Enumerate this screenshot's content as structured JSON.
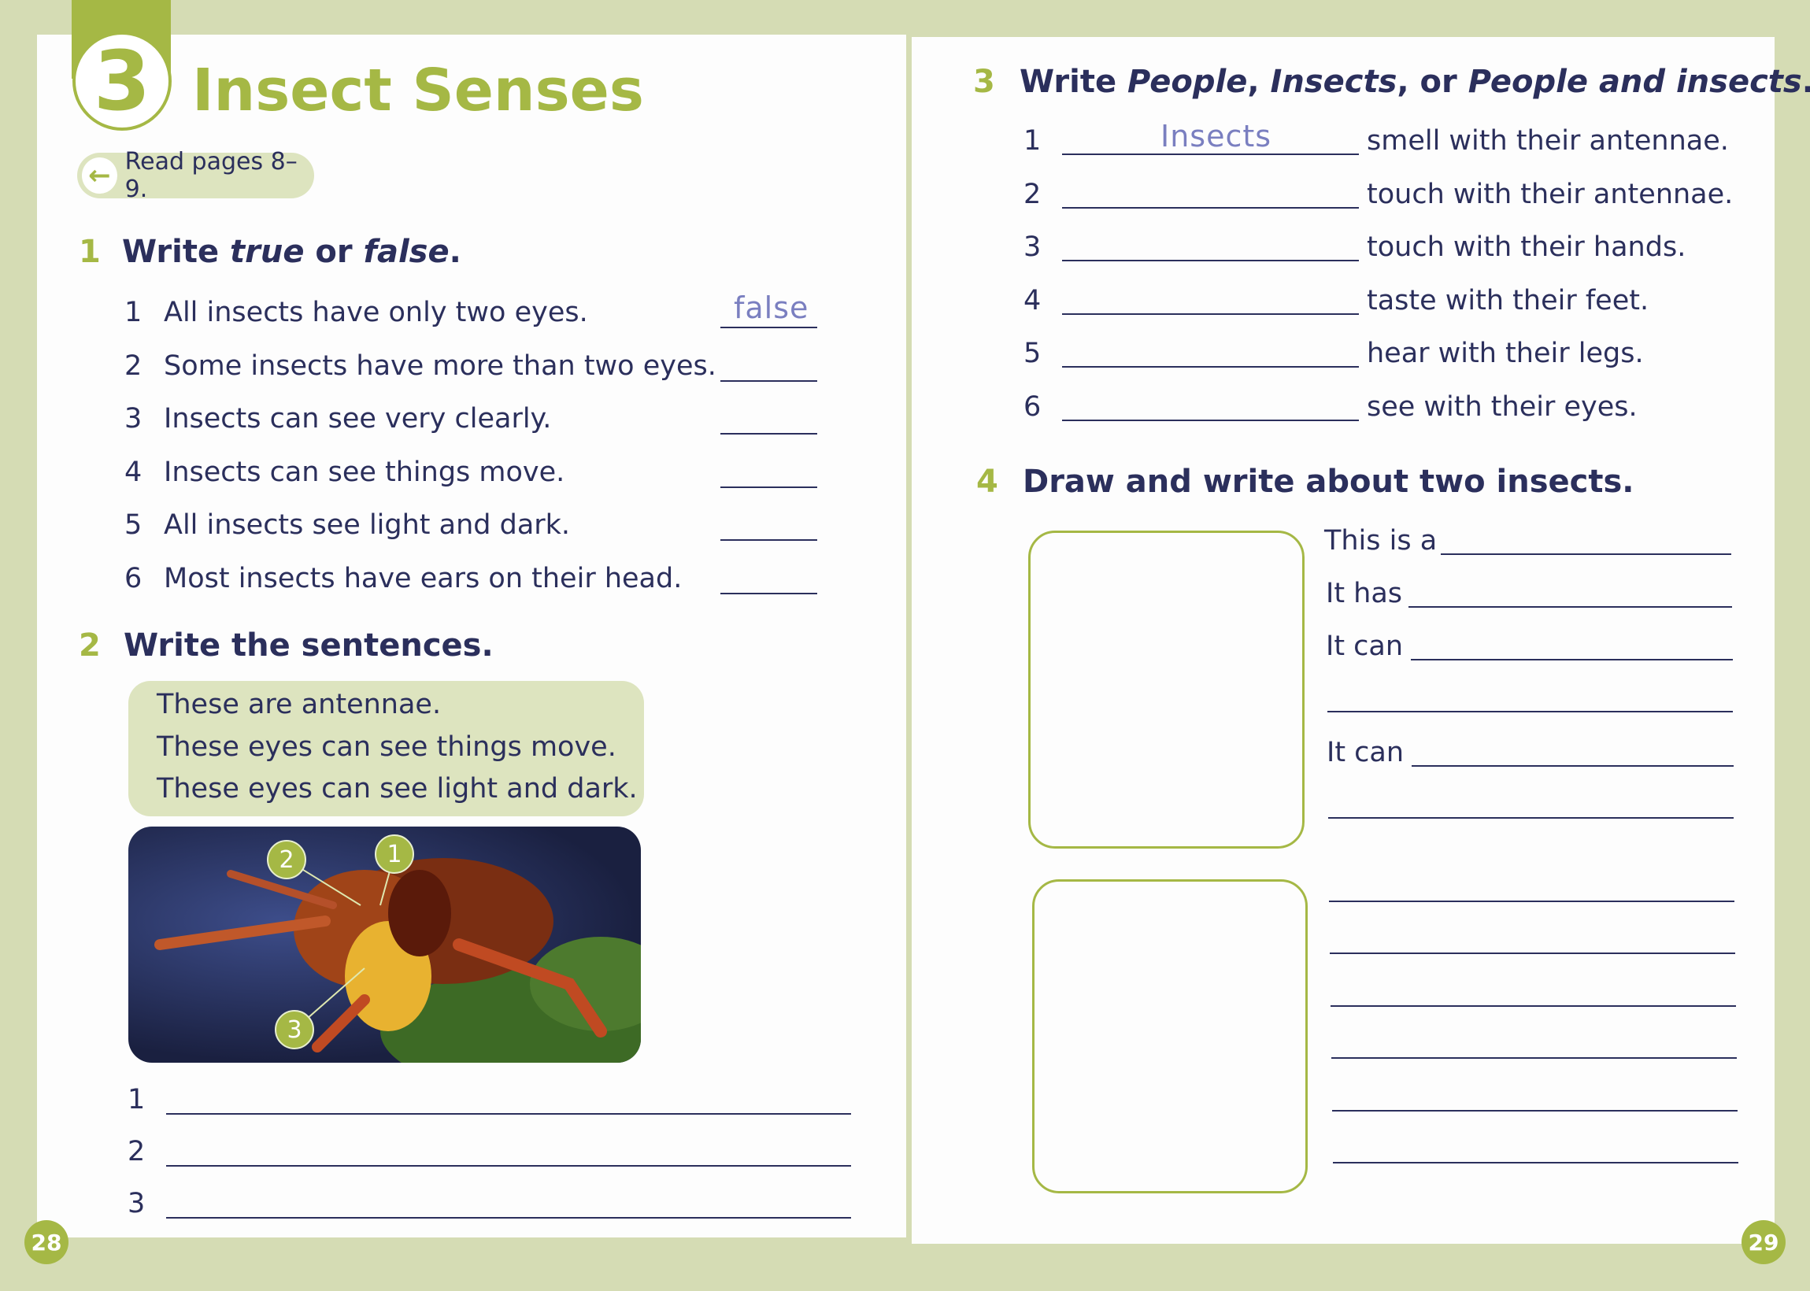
{
  "left_page": {
    "unit_number": "3",
    "title": "Insect Senses",
    "read_pill": {
      "icon": "arrow-left-icon",
      "label": "Read pages 8–9."
    },
    "ex1": {
      "number": "1",
      "instruction_a": "Write ",
      "instruction_true": "true",
      "instruction_b": " or ",
      "instruction_false": "false",
      "instruction_c": ".",
      "items": [
        {
          "n": "1",
          "text": "All insects have only two eyes.",
          "answer": "false"
        },
        {
          "n": "2",
          "text": "Some insects have more than two eyes.",
          "answer": ""
        },
        {
          "n": "3",
          "text": "Insects can see very clearly.",
          "answer": ""
        },
        {
          "n": "4",
          "text": "Insects can see things move.",
          "answer": ""
        },
        {
          "n": "5",
          "text": "All insects see light and dark.",
          "answer": ""
        },
        {
          "n": "6",
          "text": "Most insects have ears on their head.",
          "answer": ""
        }
      ]
    },
    "ex2": {
      "number": "2",
      "instruction": "Write the sentences.",
      "sentences": [
        "These are antennae.",
        "These eyes can see things move.",
        "These eyes can see light and dark."
      ],
      "photo_labels": [
        "2",
        "1",
        "3"
      ],
      "answer_numbers": [
        "1",
        "2",
        "3"
      ]
    },
    "page_number": "28"
  },
  "right_page": {
    "ex3": {
      "number": "3",
      "instruction_a": "Write ",
      "opt1": "People",
      "sep1": ", ",
      "opt2": "Insects",
      "sep2": ", or ",
      "opt3": "People and insects",
      "end": ".",
      "items": [
        {
          "n": "1",
          "answer": "Insects",
          "text": "smell with their antennae."
        },
        {
          "n": "2",
          "answer": "",
          "text": "touch with their antennae."
        },
        {
          "n": "3",
          "answer": "",
          "text": "touch with their hands."
        },
        {
          "n": "4",
          "answer": "",
          "text": "taste with their feet."
        },
        {
          "n": "5",
          "answer": "",
          "text": "hear with their legs."
        },
        {
          "n": "6",
          "answer": "",
          "text": "see with their eyes."
        }
      ]
    },
    "ex4": {
      "number": "4",
      "instruction": "Draw and write about two insects.",
      "prompts": [
        "This is a",
        "It has",
        "It can",
        "It can"
      ]
    },
    "page_number": "29"
  },
  "colors": {
    "accent_green": "#a5b845",
    "text_navy": "#2b2f5c",
    "handwriting": "#7a7fc0",
    "background": "#d5dcb4"
  }
}
